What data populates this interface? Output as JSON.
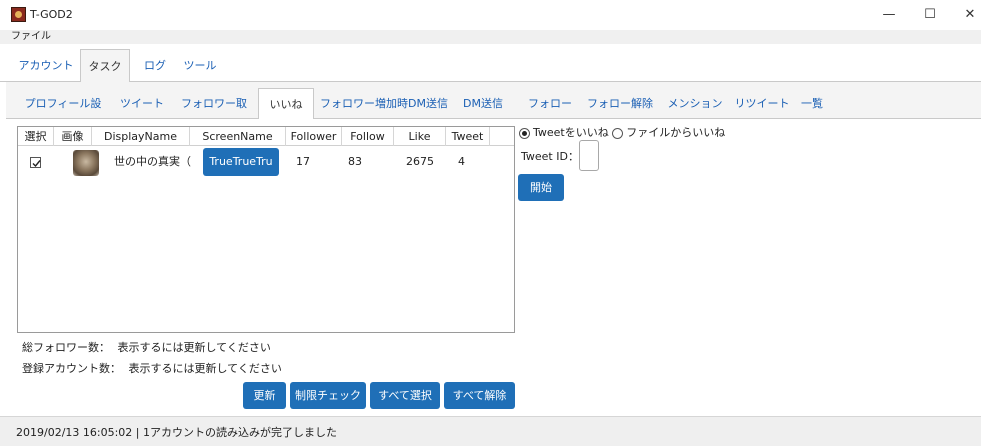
{
  "window": {
    "title": "T-GOD2",
    "minimize": "—",
    "maximize": "☐",
    "close": "✕"
  },
  "menu": {
    "file": "ファイル"
  },
  "top_tabs": [
    "アカウント",
    "タスク",
    "ログ",
    "ツール"
  ],
  "top_tabs_active": "タスク",
  "sub_tabs": [
    "プロフィール設定",
    "ツイート",
    "フォロワー取得",
    "いいね",
    "フォロワー増加時DM送信",
    "DM送信",
    "フォロー",
    "フォロー解除",
    "メンション",
    "リツイート",
    "一覧"
  ],
  "sub_tabs_active": "いいね",
  "grid": {
    "columns": [
      "選択",
      "画像",
      "DisplayName",
      "ScreenName",
      "Follower",
      "Follow",
      "Like",
      "Tweet"
    ],
    "rows": [
      {
        "selected": true,
        "display_name": "世の中の真実（",
        "screen_name": "TrueTrueTru",
        "follower": "17",
        "follow": "83",
        "like": "2675",
        "tweet": "4"
      }
    ]
  },
  "like_mode": {
    "option_tweet": "Tweetをいいね",
    "option_file": "ファイルからいいね",
    "selected": "option_tweet"
  },
  "tweet_id": {
    "label": "Tweet ID：",
    "value": ""
  },
  "start_button": "開始",
  "info": {
    "total_followers_label": "総フォロワー数：",
    "total_followers_value": "表示するには更新してください",
    "registered_accounts_label": "登録アカウント数：",
    "registered_accounts_value": "表示するには更新してください"
  },
  "actions": {
    "refresh": "更新",
    "limit_check": "制限チェック",
    "select_all": "すべて選択",
    "deselect_all": "すべて解除"
  },
  "status": "2019/02/13 16:05:02 | 1アカウントの読み込みが完了しました",
  "colors": {
    "accent": "#1f6fb7",
    "tab_link": "#1a5fb4"
  }
}
